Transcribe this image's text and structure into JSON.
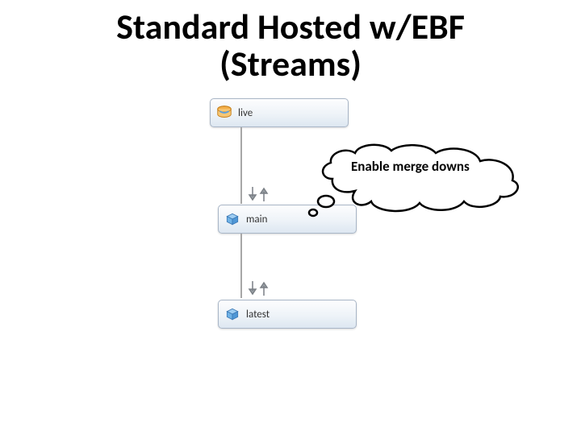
{
  "title_line1": "Standard Hosted w/EBF",
  "title_line2": "(Streams)",
  "nodes": {
    "live": {
      "label": "live",
      "icon": "disk-icon"
    },
    "main": {
      "label": "main",
      "icon": "box-icon"
    },
    "latest": {
      "label": "latest",
      "icon": "box-icon"
    }
  },
  "callout": {
    "text": "Enable merge downs"
  }
}
